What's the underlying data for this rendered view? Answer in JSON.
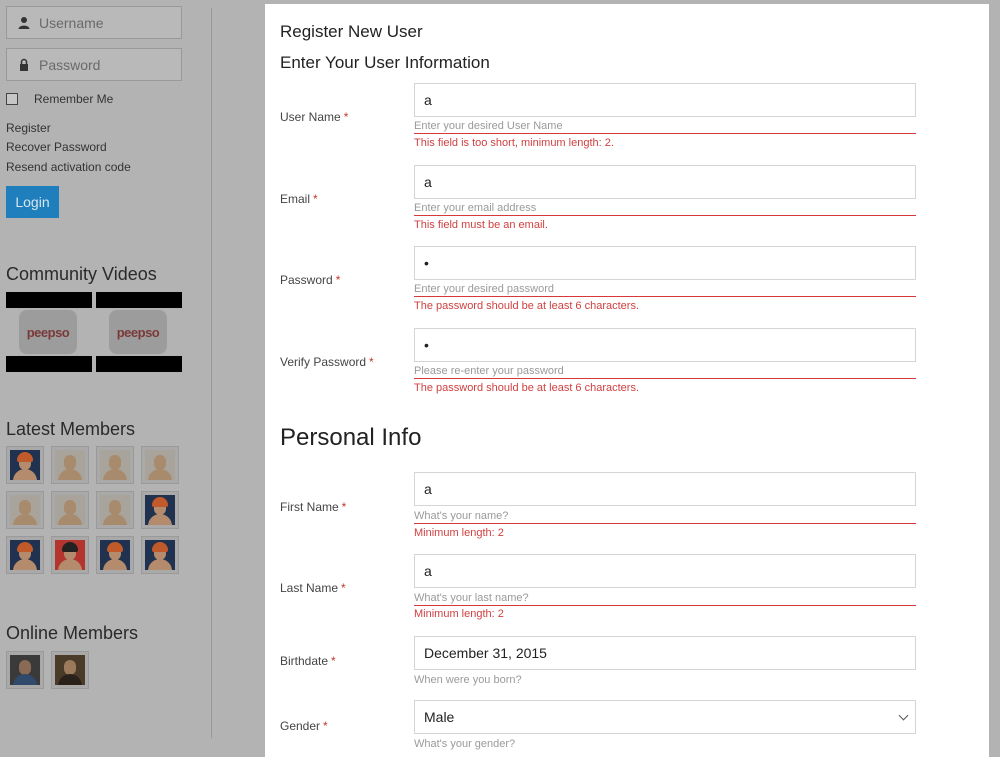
{
  "sidebar": {
    "username_placeholder": "Username",
    "password_placeholder": "Password",
    "remember_label": "Remember Me",
    "links": [
      "Register",
      "Recover Password",
      "Resend activation code"
    ],
    "login_label": "Login",
    "videos_heading": "Community Videos",
    "video_logo_text": "peepso",
    "members_heading": "Latest Members",
    "online_heading": "Online Members"
  },
  "form": {
    "title": "Register New User",
    "subtitle": "Enter Your User Information",
    "personal_title": "Personal Info",
    "fields": {
      "username": {
        "label": "User Name",
        "value": "a",
        "hint": "Enter your desired User Name",
        "error": "This field is too short, minimum length: 2."
      },
      "email": {
        "label": "Email",
        "value": "a",
        "hint": "Enter your email address",
        "error": "This field must be an email."
      },
      "password": {
        "label": "Password",
        "value": "•",
        "hint": "Enter your desired password",
        "error": "The password should be at least 6 characters."
      },
      "verify": {
        "label": "Verify Password",
        "value": "•",
        "hint": "Please re-enter your password",
        "error": "The password should be at least 6 characters."
      },
      "firstname": {
        "label": "First Name",
        "value": "a",
        "hint": "What's your name?",
        "error": "Minimum length: 2"
      },
      "lastname": {
        "label": "Last Name",
        "value": "a",
        "hint": "What's your last name?",
        "error": "Minimum length: 2"
      },
      "birthdate": {
        "label": "Birthdate",
        "value": "December 31, 2015",
        "hint": "When were you born?"
      },
      "gender": {
        "label": "Gender",
        "value": "Male",
        "hint": "What's your gender?"
      }
    },
    "required_mark": "*"
  },
  "colors": {
    "accent": "#1f7fbd",
    "error": "#d9383a"
  }
}
